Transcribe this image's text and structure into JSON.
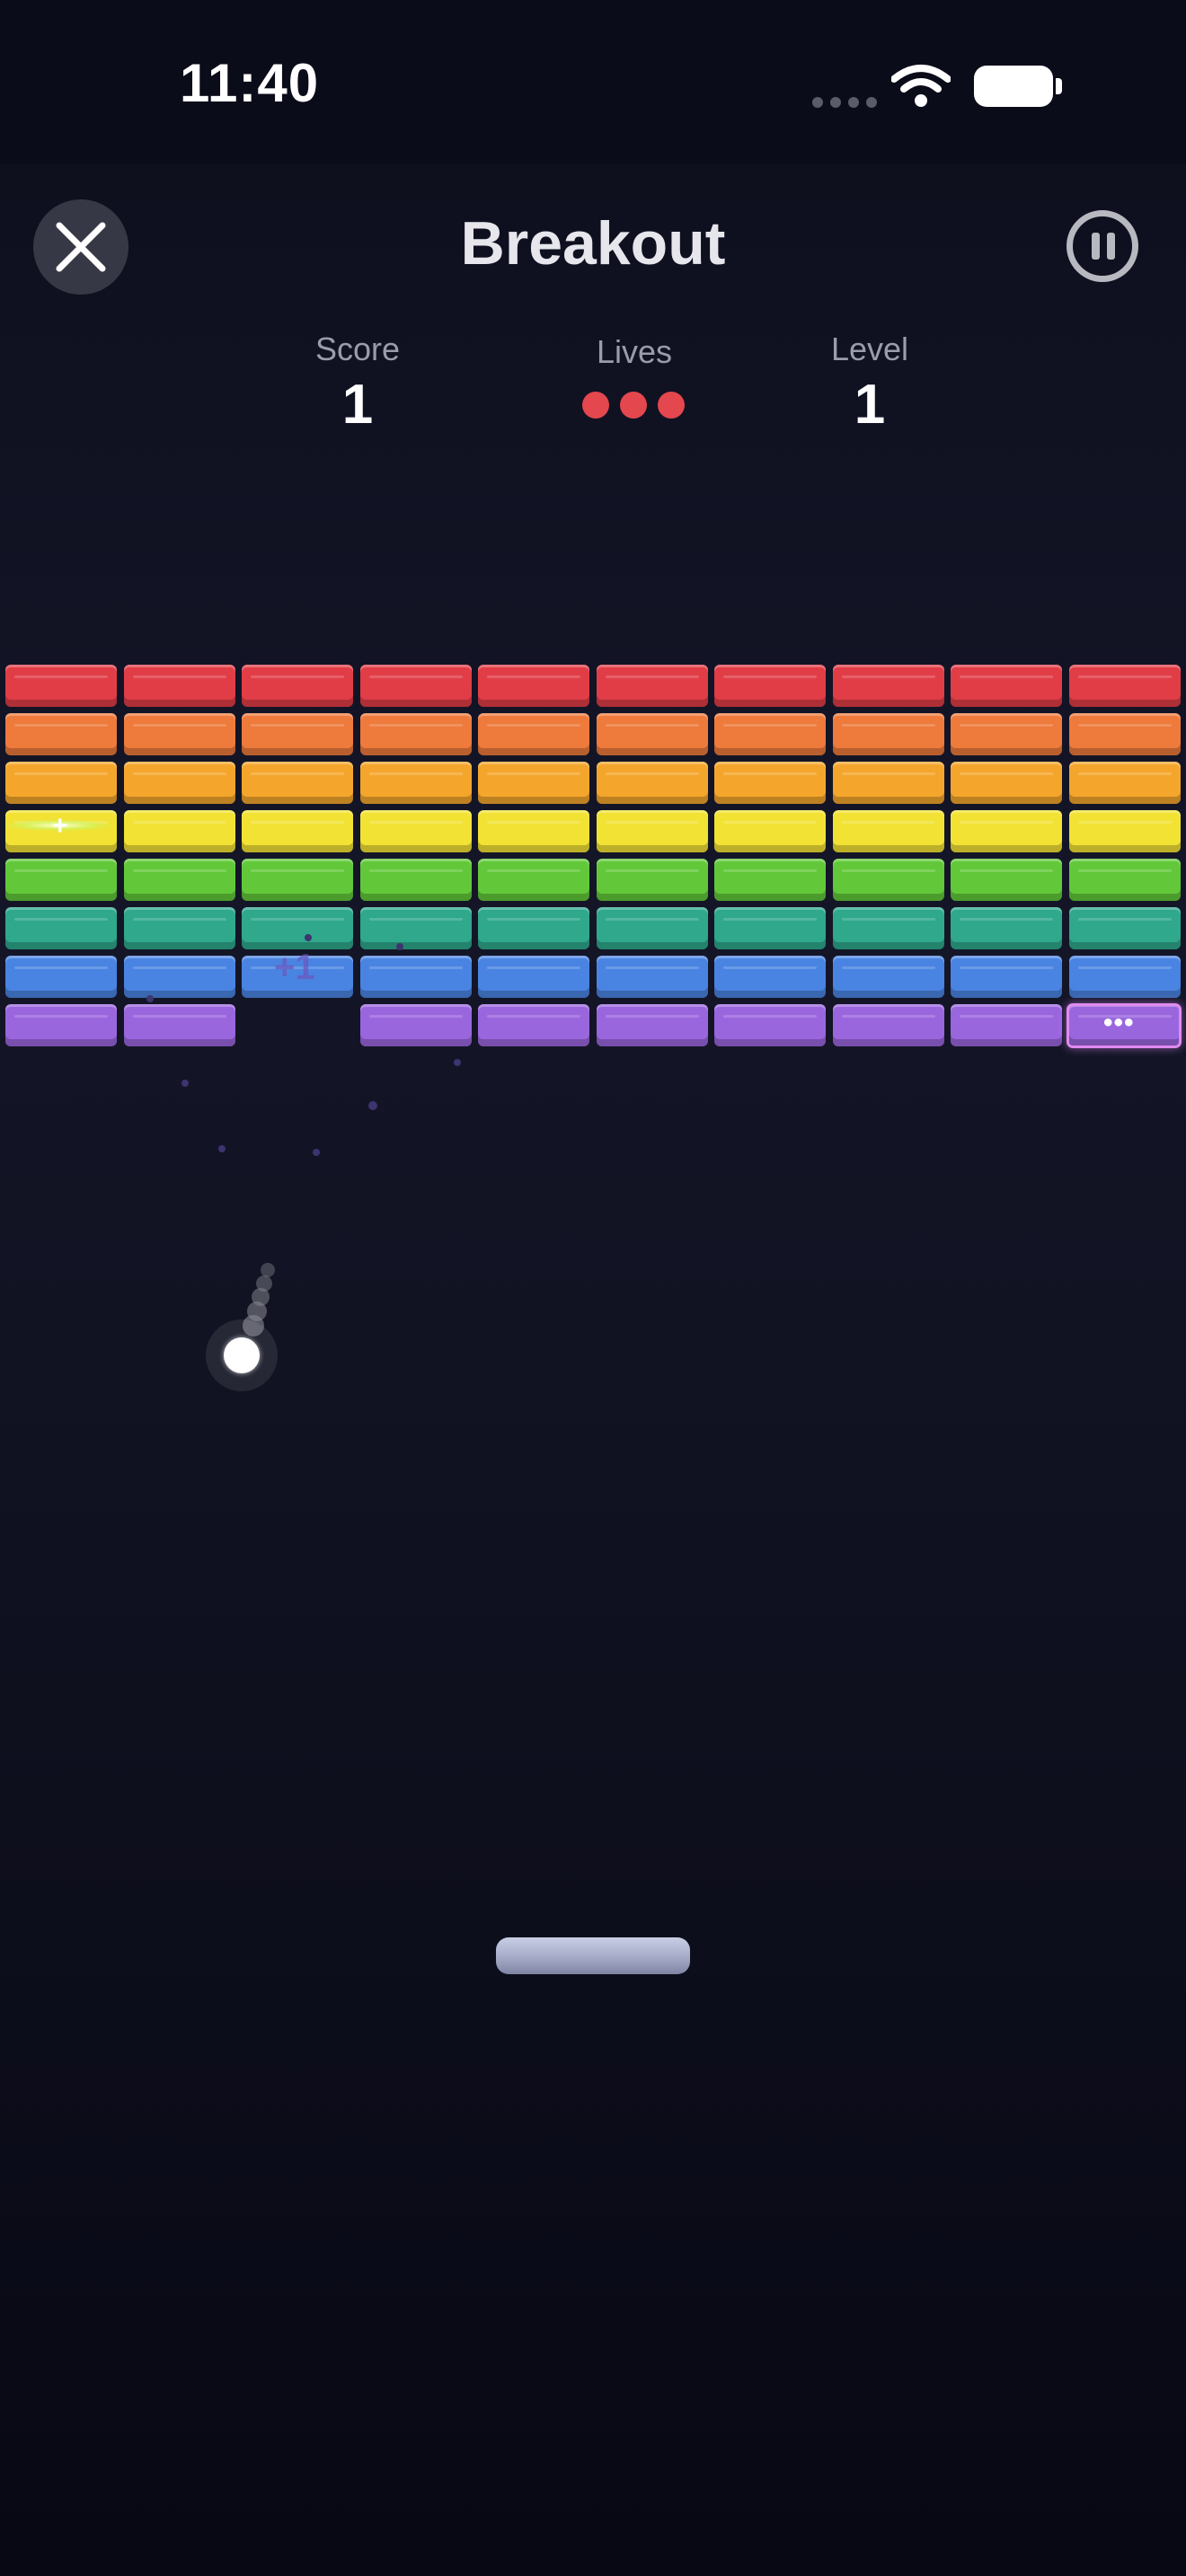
{
  "status_bar": {
    "time": "11:40"
  },
  "header": {
    "title": "Breakout",
    "close_icon": "close-icon",
    "pause_icon": "pause-icon"
  },
  "stats": {
    "score_label": "Score",
    "score_value": "1",
    "lives_label": "Lives",
    "lives_count": 3,
    "level_label": "Level",
    "level_value": "1"
  },
  "colors": {
    "background": "#0d0e1c",
    "life_dot": "#e4474d",
    "paddle": "#a5abc7",
    "ball": "#ffffff"
  },
  "bricks": {
    "rows": [
      {
        "color": "#e13d47",
        "missing": []
      },
      {
        "color": "#ee7a3c",
        "missing": []
      },
      {
        "color": "#f4a62c",
        "missing": []
      },
      {
        "color": "#f2e234",
        "missing": []
      },
      {
        "color": "#62c83a",
        "missing": []
      },
      {
        "color": "#2fa88c",
        "missing": []
      },
      {
        "color": "#4a84e2",
        "missing": []
      },
      {
        "color": "#9a66de",
        "missing": [
          2
        ]
      }
    ],
    "columns": 10,
    "powerups": [
      {
        "row": 3,
        "col": 0,
        "icon": "plus-icon"
      },
      {
        "row": 7,
        "col": 9,
        "icon": "multiball-icon"
      }
    ]
  },
  "effects": {
    "floating_score": "+1"
  }
}
